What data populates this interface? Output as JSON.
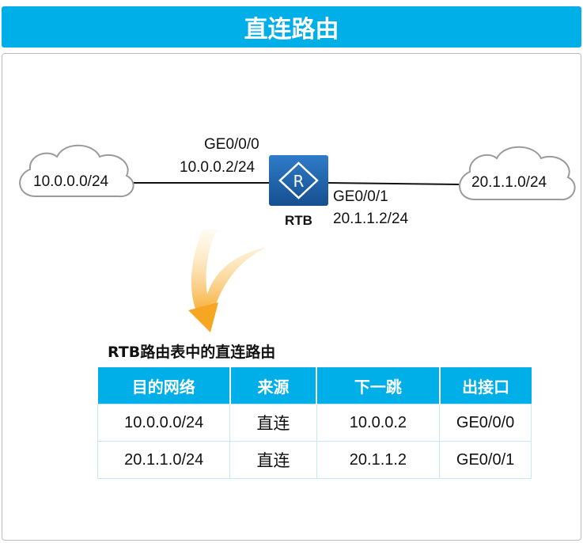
{
  "title": "直连路由",
  "clouds": {
    "left": "10.0.0.0/24",
    "right": "20.1.1.0/24"
  },
  "router": {
    "name": "RTB",
    "icon": "router-icon",
    "left_iface": {
      "name": "GE0/0/0",
      "ip": "10.0.0.2/24"
    },
    "right_iface": {
      "name": "GE0/0/1",
      "ip": "20.1.1.2/24"
    }
  },
  "colors": {
    "accent": "#00aee8",
    "router": "#1f5fa6",
    "arrow": "#f6a623"
  },
  "table": {
    "title": "RTB路由表中的直连路由",
    "headers": [
      "目的网络",
      "来源",
      "下一跳",
      "出接口"
    ],
    "rows": [
      [
        "10.0.0.0/24",
        "直连",
        "10.0.0.2",
        "GE0/0/0"
      ],
      [
        "20.1.1.0/24",
        "直连",
        "20.1.1.2",
        "GE0/0/1"
      ]
    ]
  }
}
